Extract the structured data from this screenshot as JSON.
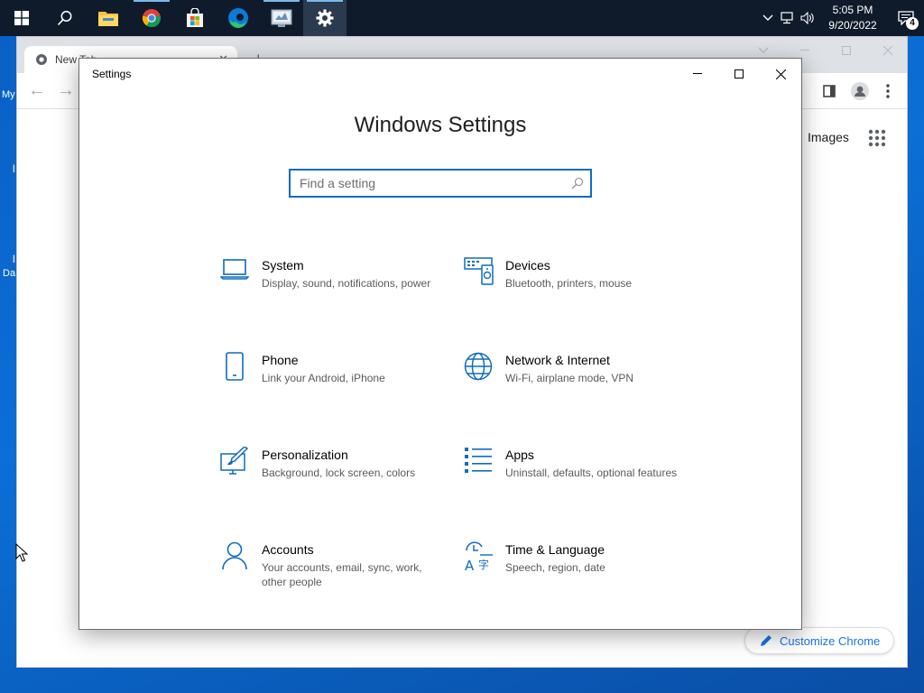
{
  "taskbar": {
    "items": [
      {
        "name": "start",
        "icon": "windows-logo-icon"
      },
      {
        "name": "search",
        "icon": "search-icon"
      },
      {
        "name": "file-explorer",
        "icon": "folder-icon"
      },
      {
        "name": "chrome",
        "icon": "chrome-icon"
      },
      {
        "name": "store",
        "icon": "store-icon"
      },
      {
        "name": "edge",
        "icon": "edge-icon"
      },
      {
        "name": "control-panel",
        "icon": "control-panel-icon"
      },
      {
        "name": "settings",
        "icon": "gear-icon"
      }
    ],
    "tray": {
      "time": "5:05 PM",
      "date": "9/20/2022",
      "notification_count": "4"
    }
  },
  "desktop": {
    "label_top": "My",
    "label_bottom": "Da"
  },
  "chrome": {
    "tab_title": "New Tab",
    "images_link": "Images",
    "customize_label": "Customize Chrome"
  },
  "settings": {
    "window_title": "Settings",
    "heading": "Windows Settings",
    "search_placeholder": "Find a setting",
    "categories": [
      {
        "name": "System",
        "description": "Display, sound, notifications, power",
        "icon": "laptop-icon"
      },
      {
        "name": "Devices",
        "description": "Bluetooth, printers, mouse",
        "icon": "devices-icon"
      },
      {
        "name": "Phone",
        "description": "Link your Android, iPhone",
        "icon": "phone-icon"
      },
      {
        "name": "Network & Internet",
        "description": "Wi-Fi, airplane mode, VPN",
        "icon": "globe-icon"
      },
      {
        "name": "Personalization",
        "description": "Background, lock screen, colors",
        "icon": "personalization-icon"
      },
      {
        "name": "Apps",
        "description": "Uninstall, defaults, optional features",
        "icon": "apps-list-icon"
      },
      {
        "name": "Accounts",
        "description": "Your accounts, email, sync, work, other people",
        "icon": "person-icon"
      },
      {
        "name": "Time & Language",
        "description": "Speech, region, date",
        "icon": "time-language-icon"
      }
    ]
  },
  "colors": {
    "accent": "#0f6cbd",
    "taskbar": "#0f1b2b",
    "desktop": "#0b6fd6"
  }
}
